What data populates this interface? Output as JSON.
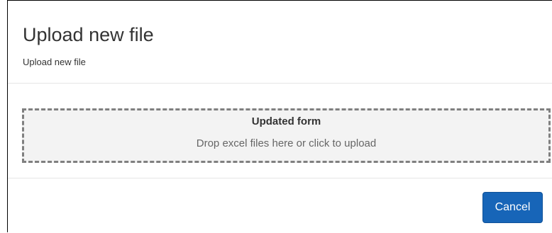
{
  "modal": {
    "title": "Upload new file",
    "subtitle": "Upload new file"
  },
  "dropzone": {
    "title": "Updated form",
    "hint": "Drop excel files here or click to upload"
  },
  "footer": {
    "cancel_label": "Cancel"
  },
  "colors": {
    "primary_button": "#1765b8",
    "dropzone_background": "#f3f3f3",
    "dropzone_border": "#808080"
  }
}
